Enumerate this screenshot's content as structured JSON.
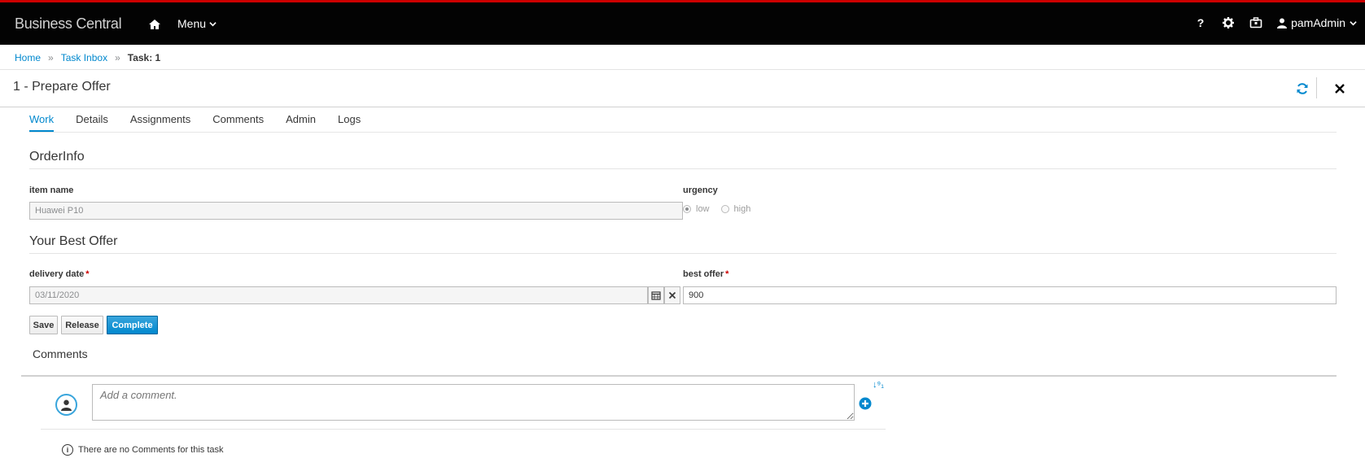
{
  "topbar": {
    "brand": "Business Central",
    "menu_label": "Menu",
    "help_label": "?",
    "user_name": "pamAdmin"
  },
  "breadcrumb": {
    "home": "Home",
    "task_inbox": "Task Inbox",
    "current": "Task: 1"
  },
  "page": {
    "title": "1 - Prepare Offer"
  },
  "tabs": [
    {
      "label": "Work",
      "active": true
    },
    {
      "label": "Details"
    },
    {
      "label": "Assignments"
    },
    {
      "label": "Comments"
    },
    {
      "label": "Admin"
    },
    {
      "label": "Logs"
    }
  ],
  "order_info": {
    "title": "OrderInfo",
    "item_name_label": "item name",
    "item_name_value": "Huawei P10",
    "urgency_label": "urgency",
    "urgency_options": [
      "low",
      "high"
    ],
    "urgency_selected": "low"
  },
  "best_offer_section": {
    "title": "Your Best Offer",
    "delivery_date_label": "delivery date",
    "delivery_date_value": "03/11/2020",
    "best_offer_label": "best offer",
    "best_offer_value": "900",
    "required_mark": "*"
  },
  "actions": {
    "save": "Save",
    "release": "Release",
    "complete": "Complete"
  },
  "comments": {
    "title": "Comments",
    "placeholder": "Add a comment.",
    "sort_label": "↓⁹₁",
    "empty_message": "There are no Comments for this task"
  },
  "colors": {
    "accent": "#0088ce",
    "topbar": "#030303",
    "topbar_border": "#cc0000",
    "required": "#cc0000"
  }
}
